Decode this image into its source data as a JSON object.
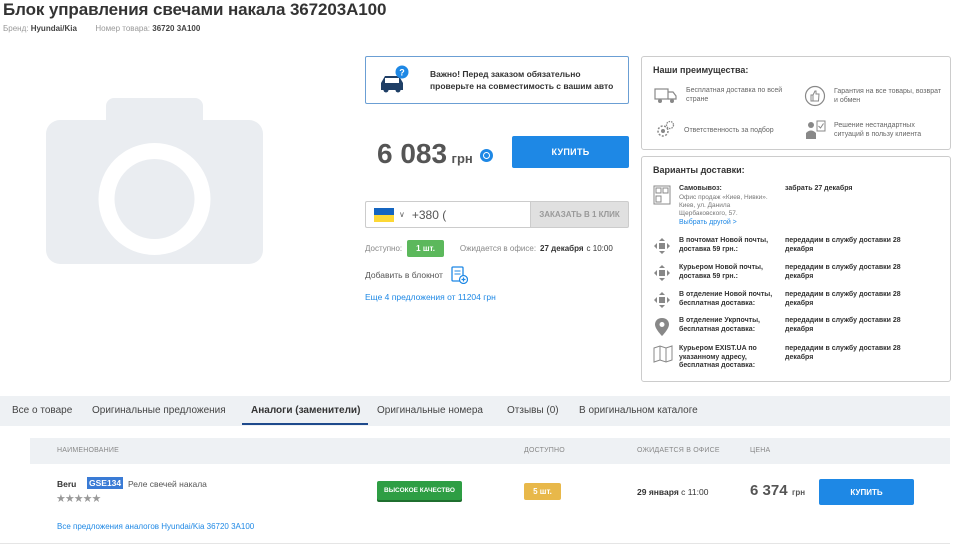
{
  "product": {
    "title": "Блок управления свечами накала 367203A100",
    "brand_label": "Бренд:",
    "brand": "Hyundai/Kia",
    "number_label": "Номер товара:",
    "number": "36720 3A100"
  },
  "notice": {
    "text": "Важно! Перед заказом обязательно проверьте на совместимость с вашим авто"
  },
  "price": {
    "value": "6 083",
    "currency": "грн",
    "buy_label": "КУПИТЬ"
  },
  "phone": {
    "prefix": "+380 (",
    "oneclick_label": "ЗАКАЗАТЬ В 1 КЛИК"
  },
  "availability": {
    "label": "Доступно:",
    "qty": "1 шт.",
    "expected_label": "Ожидается в офисе:",
    "expected_date": "27 декабря",
    "expected_time": "с 10:00"
  },
  "notebook_label": "Добавить в блокнот",
  "more_offers": "Еще 4 предложения от 11204 грн",
  "advantages": {
    "title": "Наши преимущества:",
    "items": [
      {
        "icon": "delivery-truck-icon",
        "text": "Бесплатная доставка по всей стране"
      },
      {
        "icon": "thumbs-up-icon",
        "text": "Гарантия на все товары, возврат и обмен"
      },
      {
        "icon": "gears-icon",
        "text": "Ответственность за подбор"
      },
      {
        "icon": "support-person-icon",
        "text": "Решение нестандартных ситуаций в пользу клиента"
      }
    ]
  },
  "delivery": {
    "title": "Варианты доставки:",
    "pickup": {
      "name": "Самовывоз:",
      "sub": "Офис продаж «Киев, Нивки». Киев, ул. Данила Щербаковского, 57.",
      "link": "Выбрать другой >",
      "when": "забрать 27 декабря"
    },
    "options": [
      {
        "name": "В почтомат Новой почты, доставка 59 грн.:",
        "when": "передадим в службу доставки 28 декабря"
      },
      {
        "name": "Курьером Новой почты, доставка 59 грн.:",
        "when": "передадим в службу доставки 28 декабря"
      },
      {
        "name": "В отделение Новой почты, бесплатная доставка:",
        "when": "передадим в службу доставки 28 декабря"
      },
      {
        "name": "В отделение Укрпочты, бесплатная доставка:",
        "when": "передадим в службу доставки 28 декабря"
      },
      {
        "name": "Курьером EXIST.UA по указанному адресу, бесплатная доставка:",
        "when": "передадим в службу доставки 28 декабря"
      }
    ]
  },
  "tabs": [
    {
      "label": "Все о товаре"
    },
    {
      "label": "Оригинальные предложения"
    },
    {
      "label": "Аналоги (заменители)"
    },
    {
      "label": "Оригинальные номера"
    },
    {
      "label": "Отзывы (0)"
    },
    {
      "label": "В оригинальном каталоге"
    }
  ],
  "table": {
    "headers": {
      "name": "НАИМЕНОВАНИЕ",
      "available": "ДОСТУПНО",
      "expected": "ОЖИДАЕТСЯ В ОФИСЕ",
      "price": "ЦЕНА"
    },
    "row": {
      "brand": "Beru",
      "code": "GSE134",
      "desc": "Реле свечей накала",
      "stars": "★★★★★",
      "quality": "ВЫСОКОЕ КАЧЕСТВО",
      "qty": "5 шт.",
      "expected_date": "29 января",
      "expected_time": "с 11:00",
      "price": "6 374",
      "currency": "грн",
      "buy_label": "КУПИТЬ"
    },
    "all_link": "Все предложения аналогов Hyundai/Kia 36720 3A100"
  }
}
